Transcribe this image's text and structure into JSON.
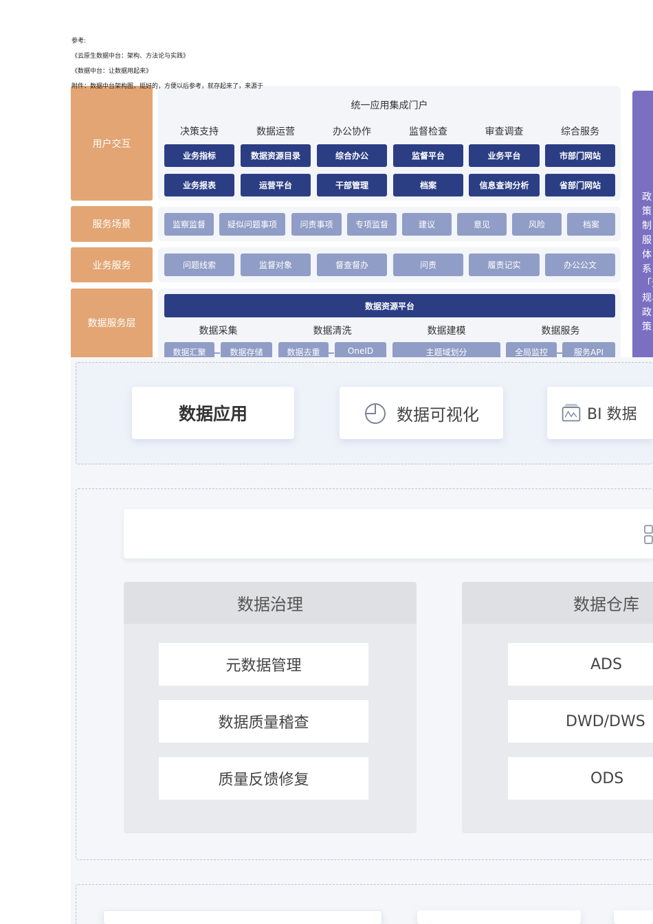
{
  "notes": [
    "参考:",
    "《云原生数据中台：架构、方法论与实践》",
    "《数据中台：让数据用起来》",
    "附件：数据中台架构图，挺好的，方便以后参考，就存起来了，来源于"
  ],
  "layers": [
    "用户交互",
    "服务场景",
    "业务服务",
    "数据服务层"
  ],
  "portal_title": "统一应用集成门户",
  "portal_columns": [
    {
      "head": "决策支持",
      "items": [
        "业务指标",
        "业务报表"
      ]
    },
    {
      "head": "数据运营",
      "items": [
        "数据资源目录",
        "运营平台"
      ]
    },
    {
      "head": "办公协作",
      "items": [
        "综合办公",
        "干部管理"
      ]
    },
    {
      "head": "监督检查",
      "items": [
        "监督平台",
        "档案"
      ]
    },
    {
      "head": "审查调查",
      "items": [
        "业务平台",
        "信息查询分析"
      ]
    },
    {
      "head": "综合服务",
      "items": [
        "市部门网站",
        "省部门网站"
      ]
    }
  ],
  "scenes": [
    "监察监督",
    "疑似问题事项",
    "问责事项",
    "专项监督",
    "建议",
    "意见",
    "风险",
    "档案"
  ],
  "biz": [
    "问题线索",
    "监督对象",
    "督查督办",
    "问责",
    "履责记实",
    "办公公文"
  ],
  "platform": "数据资源平台",
  "stages": [
    {
      "head": "数据采集",
      "items": [
        "数据汇聚",
        "数据存储"
      ]
    },
    {
      "head": "数据清洗",
      "items": [
        "数据去重",
        "OneID"
      ]
    },
    {
      "head": "数据建模",
      "items": [
        "主题域划分"
      ]
    },
    {
      "head": "数据服务",
      "items": [
        "全局监控",
        "服务API"
      ]
    }
  ],
  "side_text": "政策制服体系「法规、政策",
  "apps": [
    "数据应用",
    "数据可视化",
    "BI 数据"
  ],
  "governance": {
    "title": "数据治理",
    "items": [
      "元数据管理",
      "数据质量稽查",
      "质量反馈修复"
    ]
  },
  "warehouse": {
    "title": "数据仓库",
    "items": [
      "ADS",
      "DWD/DWS",
      "ODS"
    ]
  }
}
